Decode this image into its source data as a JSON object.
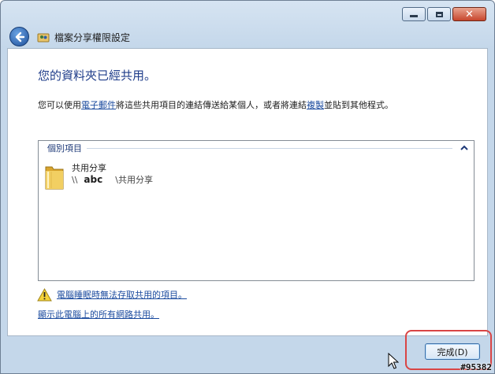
{
  "window": {
    "title": "檔案分享權限設定",
    "controls": {
      "minimize": "minimize-icon",
      "maximize": "maximize-icon",
      "close": "close-icon"
    }
  },
  "dialog": {
    "heading": "您的資料夾已經共用。",
    "desc_before": "您可以使用",
    "desc_link_email": "電子郵件",
    "desc_middle": "將這些共用項目的連結傳送給某個人，或者將連結",
    "desc_link_copy": "複製",
    "desc_after": "並貼到其他程式。"
  },
  "shared_list": {
    "group_label": "個別項目",
    "items": [
      {
        "name": "共用分享",
        "path_prefix": "\\\\",
        "host": "abc",
        "share": "\\共用分享"
      }
    ]
  },
  "warning_link": "電腦睡眠時無法存取共用的項目。",
  "show_all_link": "顯示此電腦上的所有網路共用。",
  "finish_button": "完成(D)",
  "watermark": "#95382",
  "colors": {
    "heading": "#1f3d8a",
    "link": "#1a4a9e",
    "highlight": "#d94545"
  }
}
